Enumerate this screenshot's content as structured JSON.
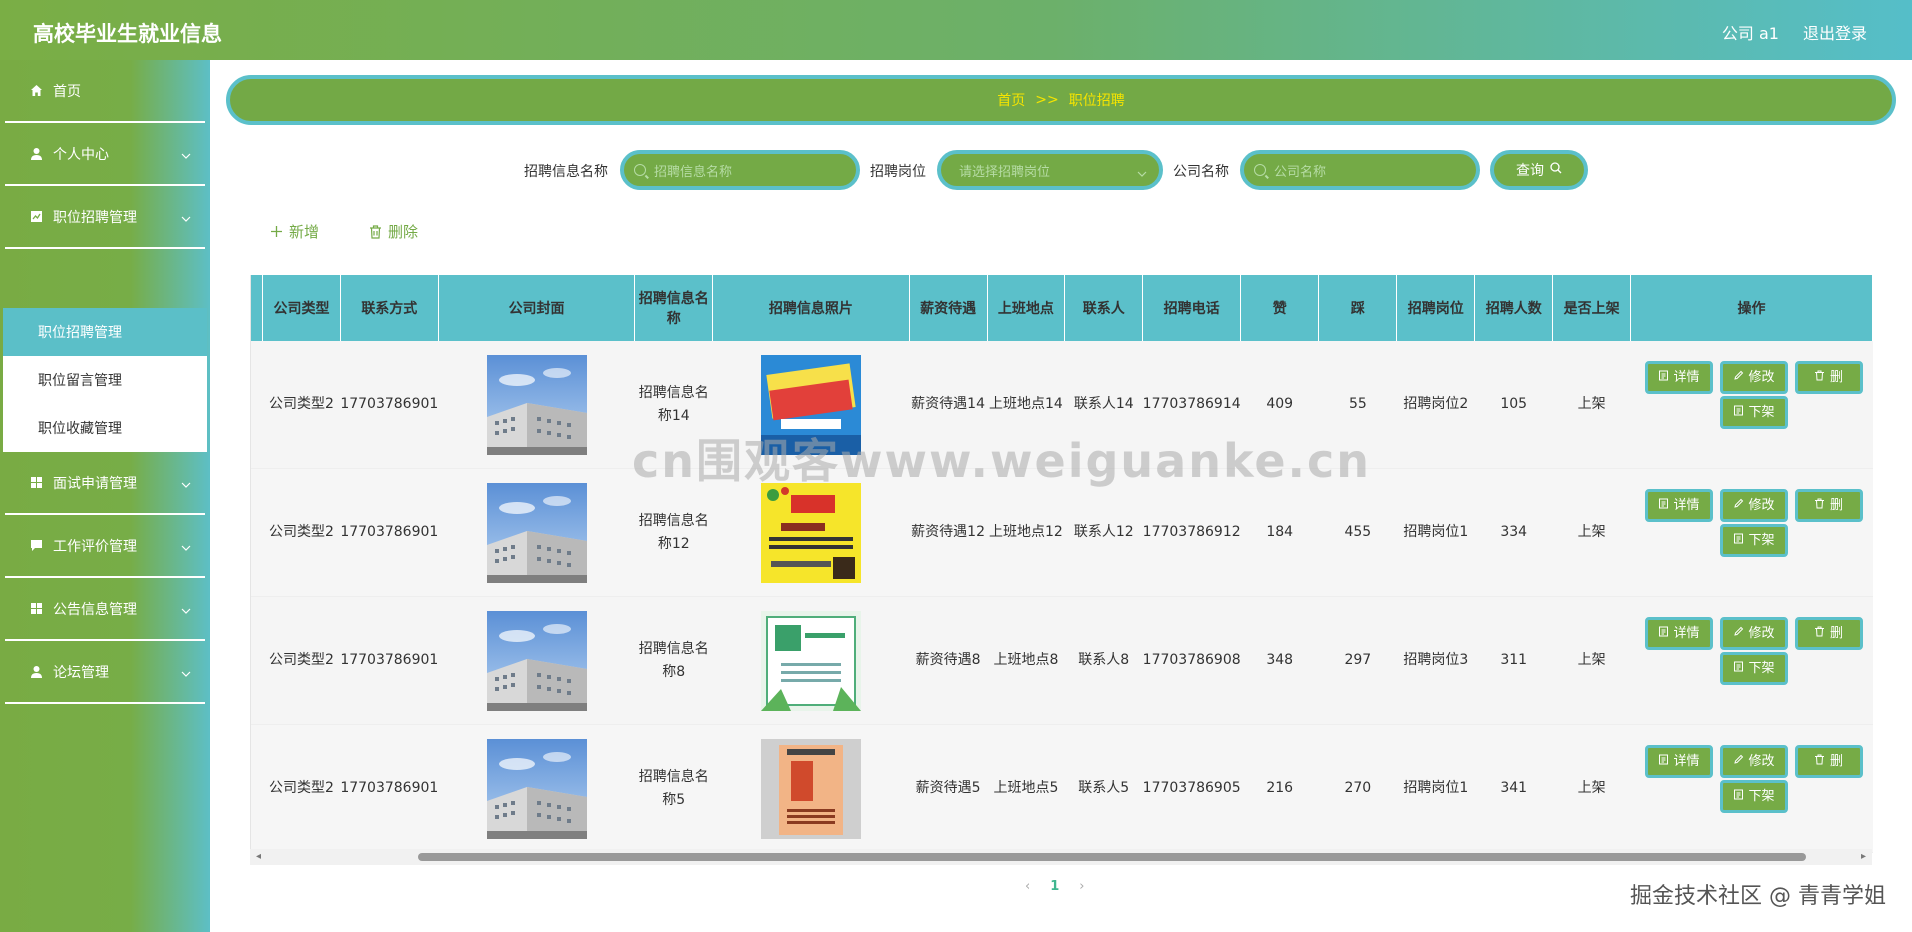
{
  "header": {
    "title": "高校毕业生就业信息",
    "user": "公司 a1",
    "logout": "退出登录"
  },
  "sidebar": {
    "items": [
      {
        "label": "首页",
        "icon": "home-icon"
      },
      {
        "label": "个人中心",
        "icon": "user-icon"
      },
      {
        "label": "职位招聘管理",
        "icon": "chart-icon"
      },
      {
        "label": "面试申请管理",
        "icon": "grid-icon"
      },
      {
        "label": "工作评价管理",
        "icon": "chat-icon"
      },
      {
        "label": "公告信息管理",
        "icon": "grid-icon"
      },
      {
        "label": "论坛管理",
        "icon": "user-icon"
      }
    ],
    "submenu": [
      "职位招聘管理",
      "职位留言管理",
      "职位收藏管理"
    ]
  },
  "breadcrumb": {
    "home": "首页",
    "sep": ">>",
    "current": "职位招聘"
  },
  "search": {
    "name_label": "招聘信息名称",
    "name_placeholder": "招聘信息名称",
    "post_label": "招聘岗位",
    "post_placeholder": "请选择招聘岗位",
    "company_label": "公司名称",
    "company_placeholder": "公司名称",
    "query": "查询"
  },
  "actions": {
    "add": "新增",
    "delete": "删除"
  },
  "table": {
    "headers": [
      "公司类型",
      "联系方式",
      "公司封面",
      "招聘信息名称",
      "招聘信息照片",
      "薪资待遇",
      "上班地点",
      "联系人",
      "招聘电话",
      "赞",
      "踩",
      "招聘岗位",
      "招聘人数",
      "是否上架",
      "操作"
    ],
    "rows": [
      {
        "type": "公司类型2",
        "contact": "17703786901",
        "name": "招聘信息名称14",
        "salary": "薪资待遇14",
        "place": "上班地点14",
        "person": "联系人14",
        "phone": "17703786914",
        "like": "409",
        "dislike": "55",
        "post": "招聘岗位2",
        "count": "105",
        "shelf": "上架"
      },
      {
        "type": "公司类型2",
        "contact": "17703786901",
        "name": "招聘信息名称12",
        "salary": "薪资待遇12",
        "place": "上班地点12",
        "person": "联系人12",
        "phone": "17703786912",
        "like": "184",
        "dislike": "455",
        "post": "招聘岗位1",
        "count": "334",
        "shelf": "上架"
      },
      {
        "type": "公司类型2",
        "contact": "17703786901",
        "name": "招聘信息名称8",
        "salary": "薪资待遇8",
        "place": "上班地点8",
        "person": "联系人8",
        "phone": "17703786908",
        "like": "348",
        "dislike": "297",
        "post": "招聘岗位3",
        "count": "311",
        "shelf": "上架"
      },
      {
        "type": "公司类型2",
        "contact": "17703786901",
        "name": "招聘信息名称5",
        "salary": "薪资待遇5",
        "place": "上班地点5",
        "person": "联系人5",
        "phone": "17703786905",
        "like": "216",
        "dislike": "270",
        "post": "招聘岗位1",
        "count": "341",
        "shelf": "上架"
      }
    ],
    "ops": {
      "detail": "详情",
      "edit": "修改",
      "delete": "删",
      "offshelf": "下架"
    }
  },
  "pagination": {
    "current": "1"
  },
  "watermark": "cn围观客www.weiguanke.cn",
  "credit": "掘金技术社区 @ 青青学姐",
  "colors": {
    "green": "#76ab46",
    "teal": "#5bc0ca",
    "yellow": "#f5e400"
  }
}
